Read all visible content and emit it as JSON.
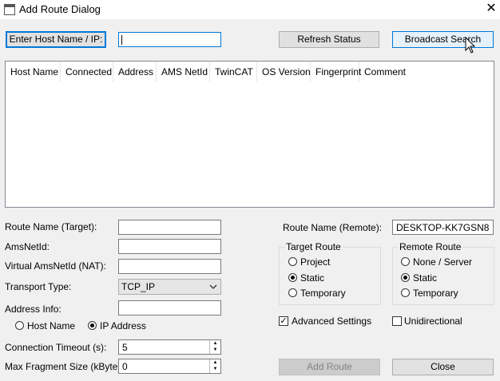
{
  "window": {
    "title": "Add Route Dialog"
  },
  "toolbar": {
    "enter_host_label": "Enter Host Name / IP:",
    "host_input_value": "",
    "refresh_label": "Refresh Status",
    "broadcast_label": "Broadcast Search"
  },
  "table": {
    "columns": [
      "Host Name",
      "Connected",
      "Address",
      "AMS NetId",
      "TwinCAT",
      "OS Version",
      "Fingerprint",
      "Comment"
    ]
  },
  "form": {
    "route_name_target_label": "Route Name (Target):",
    "route_name_target_value": "",
    "amsnetid_label": "AmsNetId:",
    "amsnetid_value": "",
    "virtual_amsnetid_label": "Virtual AmsNetId (NAT):",
    "virtual_amsnetid_value": "",
    "transport_type_label": "Transport Type:",
    "transport_type_value": "TCP_IP",
    "address_info_label": "Address Info:",
    "address_info_value": "",
    "host_name_radio": "Host Name",
    "ip_address_radio": "IP Address",
    "conn_timeout_label": "Connection Timeout (s):",
    "conn_timeout_value": "5",
    "max_fragment_label": "Max Fragment Size (kByte):",
    "max_fragment_value": "0"
  },
  "remote": {
    "route_name_remote_label": "Route Name (Remote):",
    "route_name_remote_value": "DESKTOP-KK7GSN8"
  },
  "target_route": {
    "title": "Target Route",
    "project": "Project",
    "static": "Static",
    "temporary": "Temporary"
  },
  "remote_route": {
    "title": "Remote Route",
    "none_server": "None / Server",
    "static": "Static",
    "temporary": "Temporary"
  },
  "options": {
    "advanced_settings": "Advanced Settings",
    "unidirectional": "Unidirectional"
  },
  "footer": {
    "add_route_label": "Add Route",
    "close_label": "Close"
  }
}
